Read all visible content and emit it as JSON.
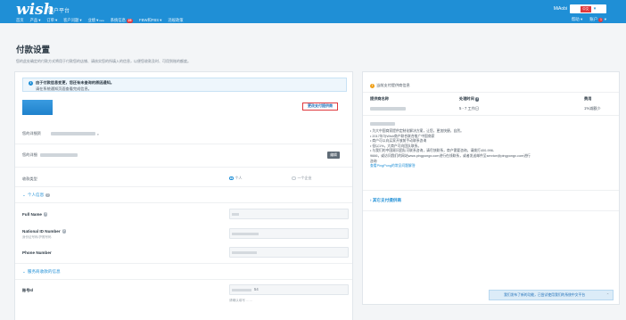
{
  "header": {
    "logo": "wish",
    "portal": "商户平台",
    "nav": [
      {
        "label": "首页",
        "caret": false,
        "badge": ""
      },
      {
        "label": "产品",
        "caret": true,
        "badge": ""
      },
      {
        "label": "订单",
        "caret": true,
        "badge": ""
      },
      {
        "label": "客户问题",
        "caret": true,
        "badge": ""
      },
      {
        "label": "业绩",
        "caret": true,
        "badge": "new"
      },
      {
        "label": "系统信息",
        "caret": false,
        "badge": "25"
      },
      {
        "label": "FBW和FBS",
        "caret": true,
        "badge": ""
      },
      {
        "label": "违规政策",
        "caret": false,
        "badge": ""
      }
    ],
    "user": "MiAobi",
    "lang": "中文",
    "help": "帮助",
    "account": "账户",
    "account_badge": "1"
  },
  "page": {
    "title": "付款设置",
    "subtitle": "您的此处确定的付款方式将用于付款您的店铺、请核实您的所填入的信息，以便您收款及时、可用到账的额度。"
  },
  "left": {
    "alert_line1": "由于付款信息变更，您还有未查询的原因通知。",
    "alert_line2": "请在系统通知页面查看完成信息。",
    "change_provider": "更改支付提供商",
    "account_label": "您的详细资",
    "account_suffix": "。",
    "detail_label": "您的详细",
    "edit": "编辑",
    "payee_type_label": "收款类型",
    "radio_individual": "个人",
    "radio_company": "一个企业",
    "personal_info": "个人信息",
    "full_name": "Full Name",
    "national_id": "National ID Number",
    "national_id_hint": "身份证号码/护照号码",
    "phone": "Phone Number",
    "service_info": "服务商收款的信息",
    "account_id": "账号Id",
    "account_id_tail": "54",
    "bottom_hint": "请确认填写 ……"
  },
  "right": {
    "title": "当前支付提供商信息",
    "col_provider": "提供商名称",
    "col_time": "处理时间",
    "col_fee": "费用",
    "time_value": "5 - 7 工作日",
    "fee_value": "1%减额少",
    "bullets": [
      "为大中国商家提供定制化解决方案，让您，更加快捷，自然。",
      "2017年与Wish商户联合联合推广中国商家",
      "商户可以向买家开放前手动联系咨询",
      "但以1%，大商户可向团队联系。",
      "与我们的中国顾问团队可联系咨询，请尽快联系，商户需要咨询，请拨打400-996-",
      "9666，或访问我们的网站www.pingpongx.com进行在线联系，或者发送邮件至service@pingpongx.com进行",
      "咨询"
    ],
    "faq_link": "查看PingPong的常见问题解答",
    "others": "其它支付提供商"
  },
  "toast": "我们发布了新的功能，已尝试使用我们的系统中文平台"
}
